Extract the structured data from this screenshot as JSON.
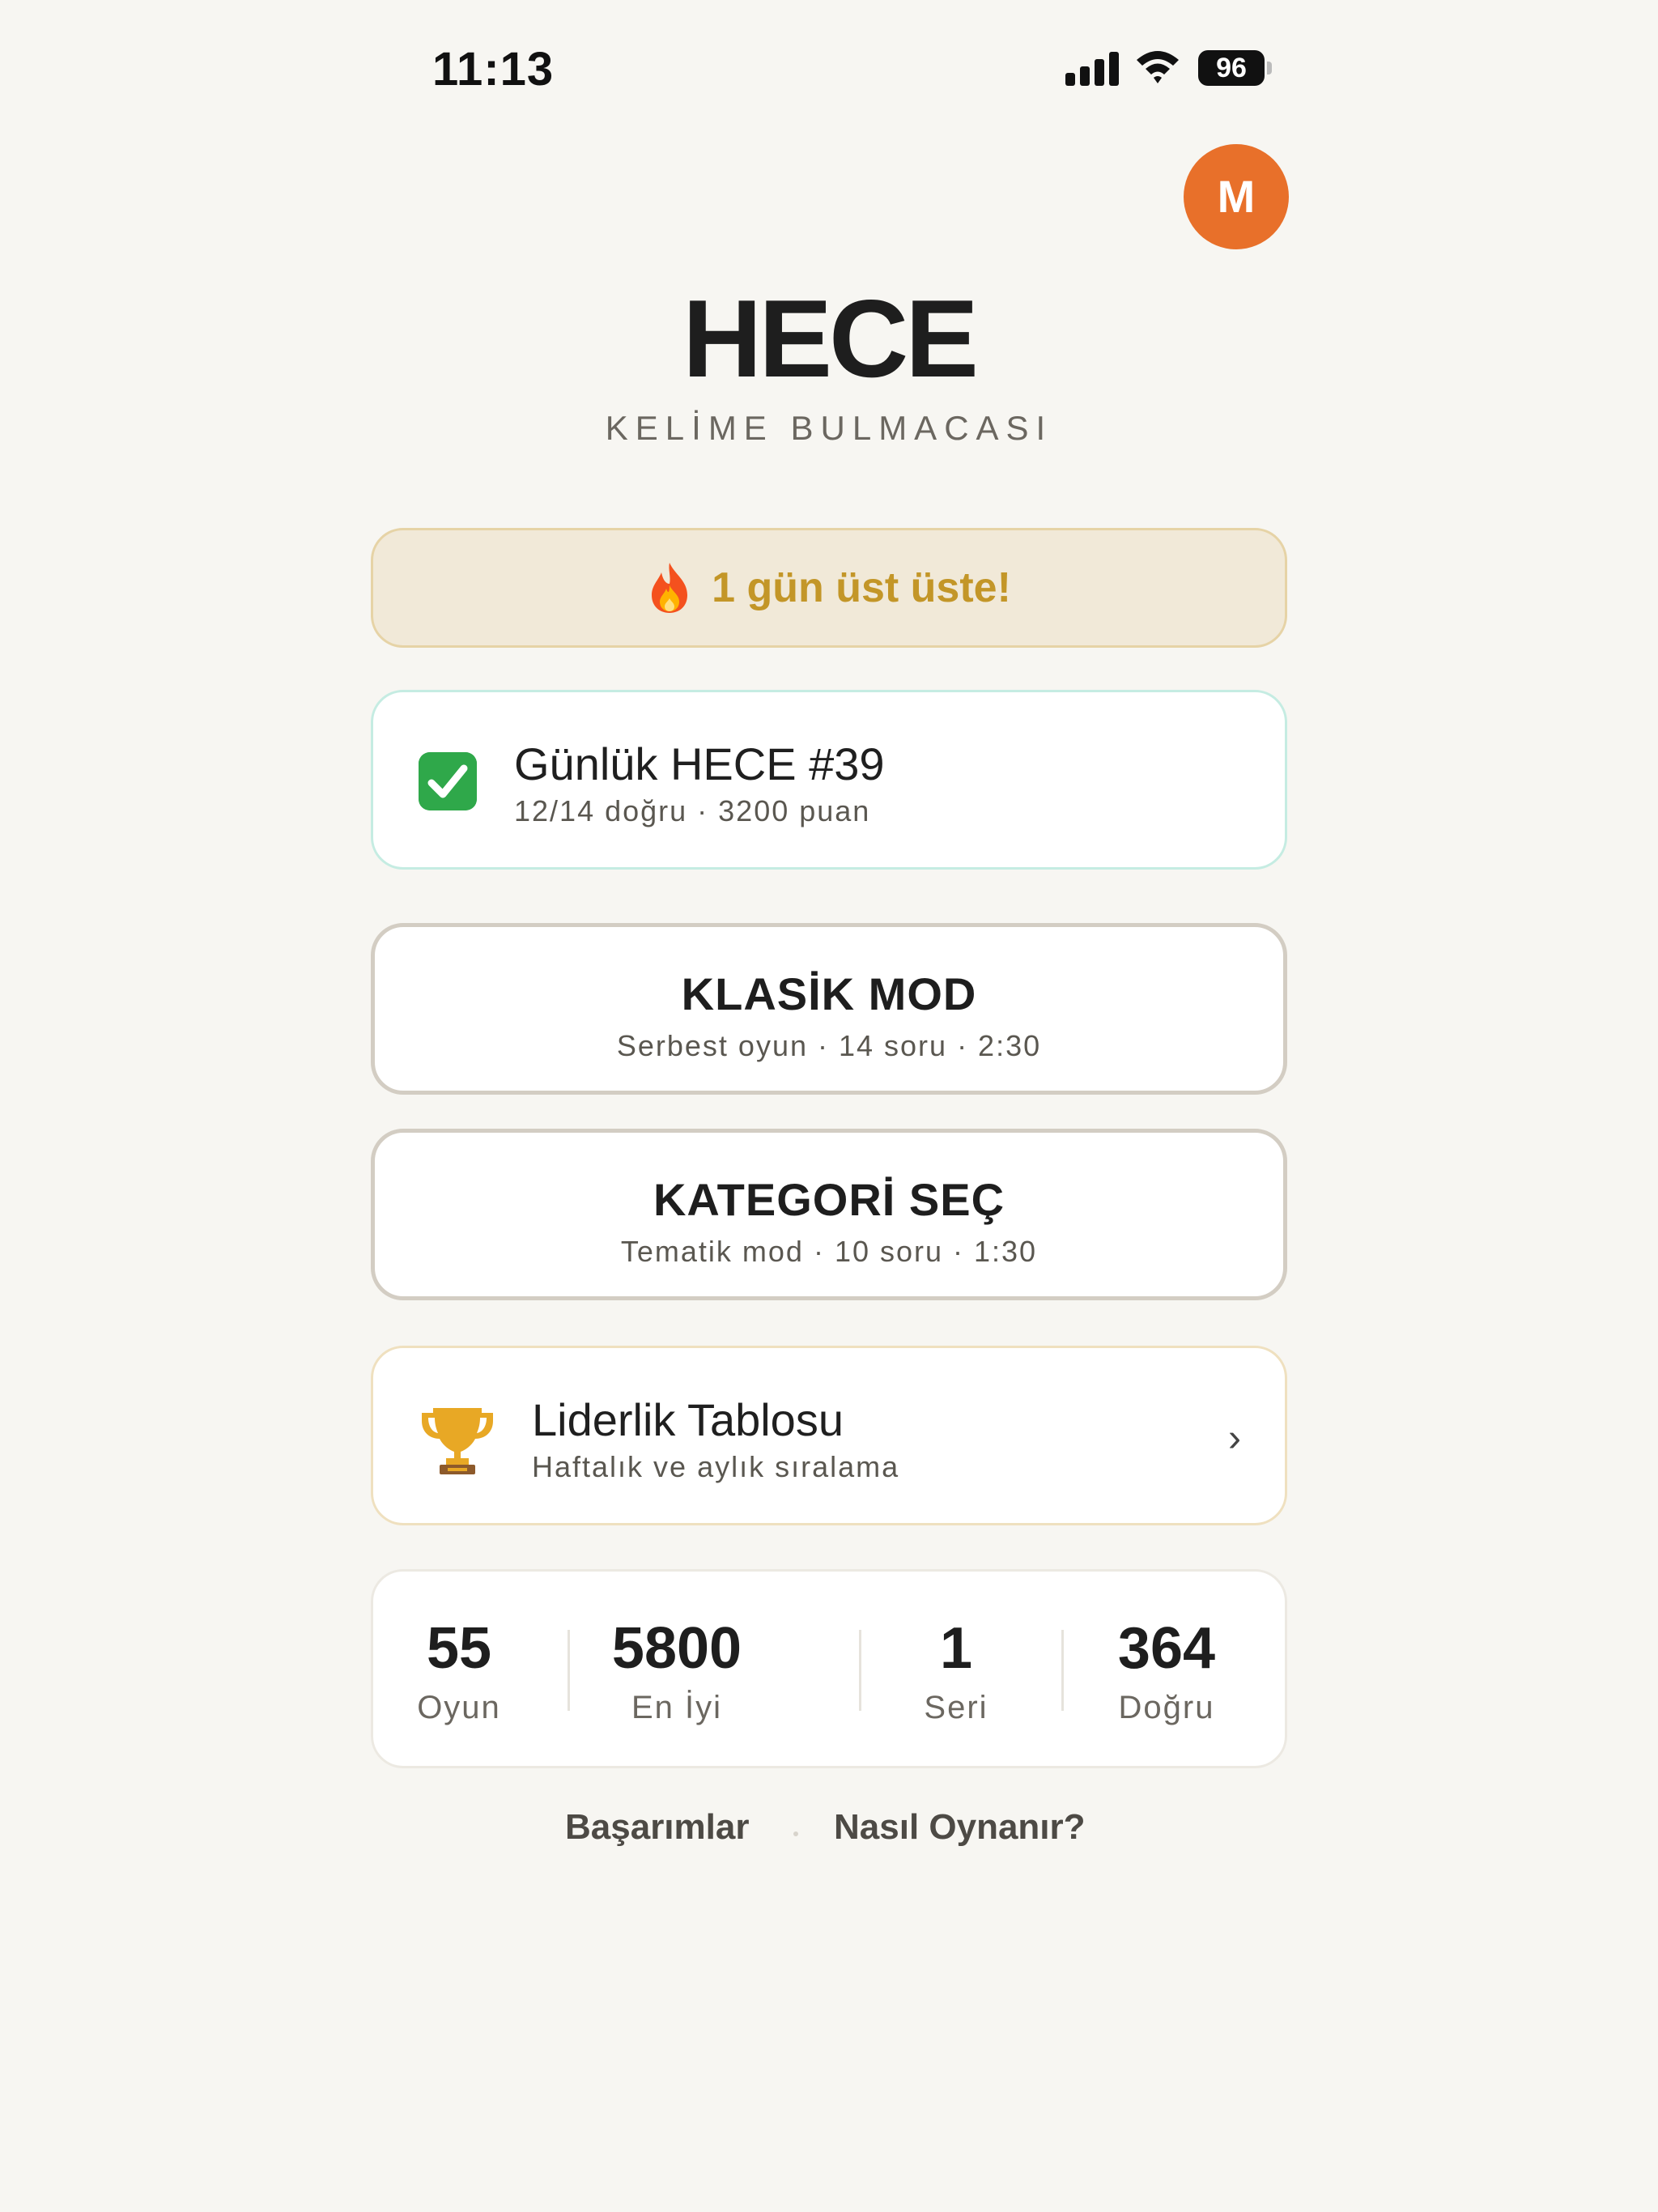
{
  "status_bar": {
    "time": "11:13",
    "battery": "96"
  },
  "avatar": {
    "initial": "M",
    "color": "#e8702a"
  },
  "header": {
    "title": "HECE",
    "subtitle": "KELİME BULMACASI"
  },
  "streak": {
    "text": "1 gün üst üste!",
    "icon": "fire-icon"
  },
  "daily": {
    "icon": "check-icon",
    "title": "Günlük HECE #39",
    "subtitle": "12/14 doğru · 3200 puan"
  },
  "modes": [
    {
      "title": "KLASİK MOD",
      "subtitle": "Serbest oyun · 14 soru · 2:30"
    },
    {
      "title": "KATEGORİ SEÇ",
      "subtitle": "Tematik mod · 10 soru · 1:30"
    }
  ],
  "leaderboard": {
    "icon": "trophy-icon",
    "title": "Liderlik Tablosu",
    "subtitle": "Haftalık ve aylık sıralama"
  },
  "stats": [
    {
      "value": "55",
      "label": "Oyun"
    },
    {
      "value": "5800",
      "label": "En İyi"
    },
    {
      "value": "1",
      "label": "Seri"
    },
    {
      "value": "364",
      "label": "Doğru"
    }
  ],
  "footer": {
    "achievements": "Başarımlar",
    "how_to_play": "Nasıl Oynanır?"
  },
  "colors": {
    "accent": "#e8702a",
    "streak_text": "#c39628",
    "background": "#f7f6f2"
  }
}
